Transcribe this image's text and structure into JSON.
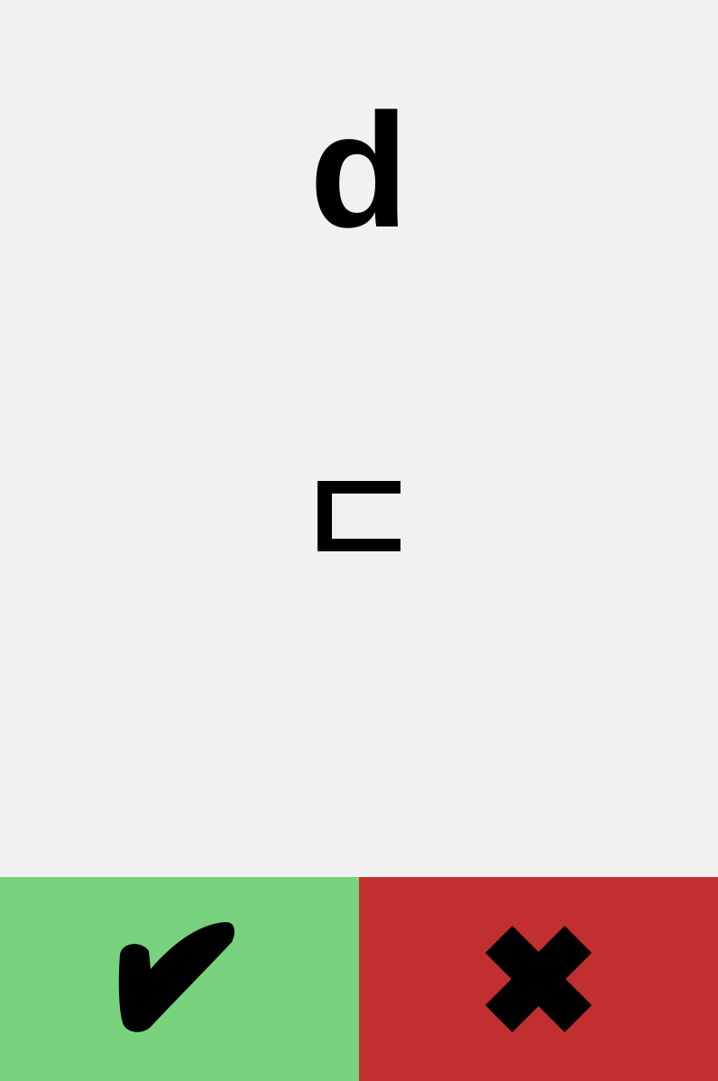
{
  "card": {
    "prompt": "d",
    "answer_icon": "korean-digeut-icon"
  },
  "actions": {
    "correct": {
      "icon": "checkmark-icon",
      "color": "#78d27e"
    },
    "wrong": {
      "icon": "cross-icon",
      "color": "#c22f30"
    }
  },
  "colors": {
    "background": "#f1f1f1",
    "ink": "#000000"
  }
}
